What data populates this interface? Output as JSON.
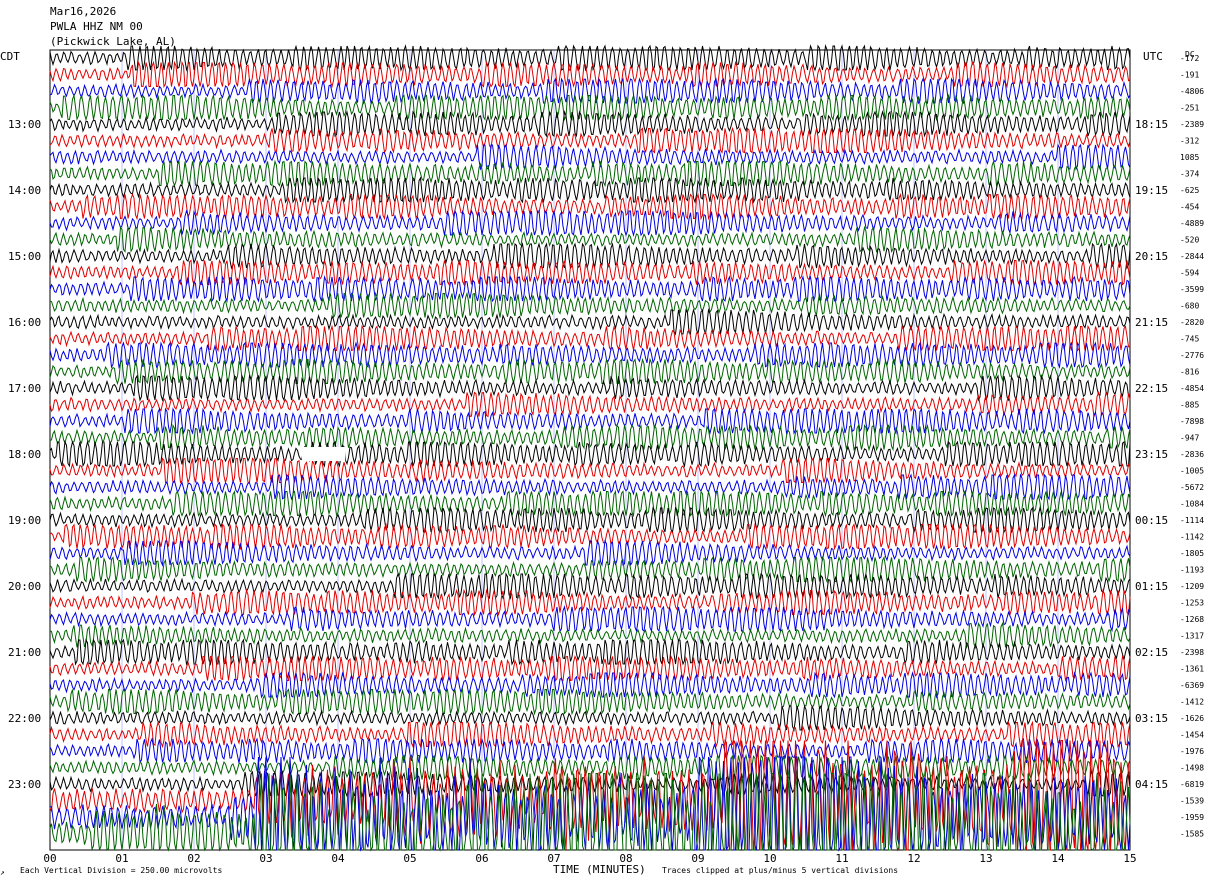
{
  "header": {
    "date": "Mar16,2026",
    "station": "PWLA HHZ NM 00",
    "location": "(Pickwick Lake, AL)"
  },
  "timezones": {
    "left": "CDT",
    "right": "UTC",
    "dc_label": "DC"
  },
  "colors": {
    "cycle": [
      "#000000",
      "#e00000",
      "#0000e0",
      "#006400"
    ],
    "grid": "#8080ff",
    "gap": "#ffffff"
  },
  "chart_data": {
    "type": "line",
    "title": "",
    "xlabel": "TIME (MINUTES)",
    "ylabel": "",
    "x_ticks": [
      "00",
      "01",
      "02",
      "03",
      "04",
      "05",
      "06",
      "07",
      "08",
      "09",
      "10",
      "11",
      "12",
      "13",
      "14",
      "15"
    ],
    "xlim": [
      0,
      15
    ],
    "trace_count": 48,
    "minutes_per_trace": 15,
    "left_time_labels": [
      "13:00",
      "14:00",
      "15:00",
      "16:00",
      "17:00",
      "18:00",
      "19:00",
      "20:00",
      "21:00",
      "22:00",
      "23:00"
    ],
    "right_time_labels": [
      "18:15",
      "19:15",
      "20:15",
      "21:15",
      "22:15",
      "23:15",
      "00:15",
      "01:15",
      "02:15",
      "03:15",
      "04:15"
    ],
    "dc_offsets": [
      "-172",
      "-191",
      "-4806",
      "-251",
      "-2389",
      "-312",
      "1085",
      "-374",
      "-625",
      "-454",
      "-4889",
      "-520",
      "-2844",
      "-594",
      "-3599",
      "-680",
      "-2820",
      "-745",
      "-2776",
      "-816",
      "-4854",
      "-885",
      "-7898",
      "-947",
      "-2836",
      "-1005",
      "-5672",
      "-1084",
      "-1114",
      "-1142",
      "-1805",
      "-1193",
      "-1209",
      "-1253",
      "-1268",
      "-1317",
      "-2398",
      "-1361",
      "-6369",
      "-1412",
      "-1626",
      "-1454",
      "-1976",
      "-1498",
      "-6819",
      "-1539",
      "-1959",
      "-1585"
    ],
    "data_gap": {
      "trace_index": 24,
      "start_minute": 3.5,
      "end_minute": 4.1
    },
    "clipped_traces": [
      45,
      46,
      47
    ],
    "amplitude_scale": "Each Vertical Division = 250.00 microvolts",
    "clip_note": "Traces clipped at plus/minus 5 vertical divisions"
  },
  "footer": {
    "scale": "Each Vertical Division = 250.00 microvolts",
    "xlabel": "TIME (MINUTES)",
    "clip": "Traces clipped at plus/minus 5 vertical divisions",
    "mark": "↗"
  }
}
